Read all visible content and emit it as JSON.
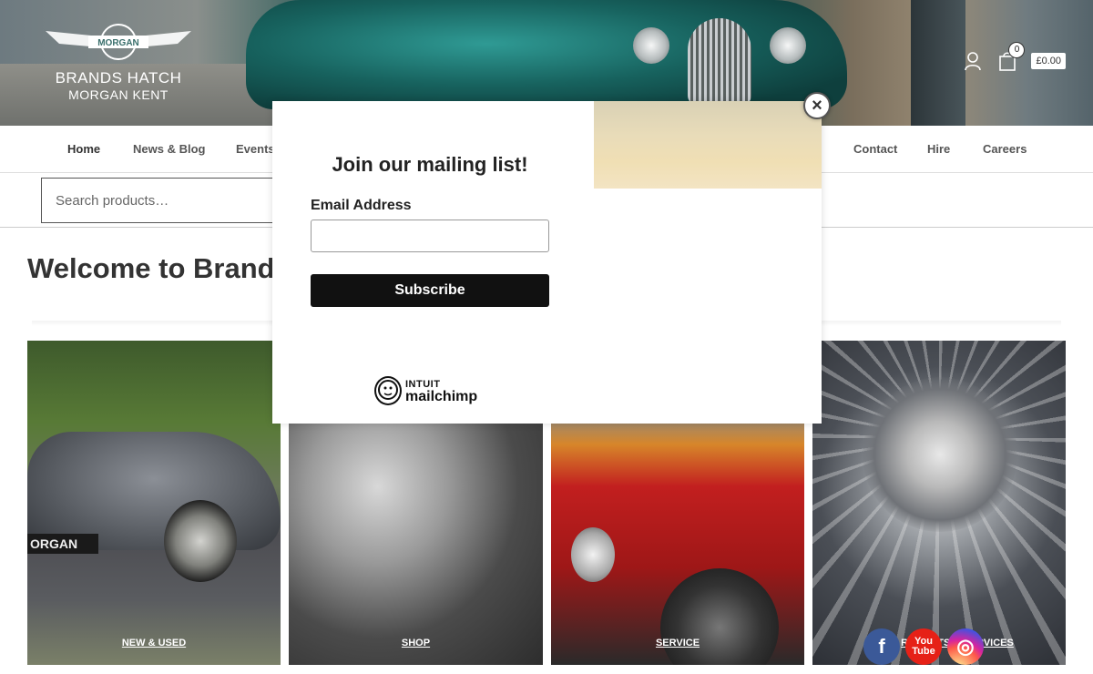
{
  "header": {
    "logo_line1": "BRANDS HATCH",
    "logo_line2": "MORGAN KENT",
    "logo_badge": "MORGAN",
    "cart_count": "0",
    "cart_total": "£0.00",
    "icons": [
      "user-icon",
      "shopping-bag-icon"
    ]
  },
  "nav": {
    "items": [
      "Home",
      "News & Blog",
      "Events",
      "Contact",
      "Hire",
      "Careers"
    ]
  },
  "search": {
    "placeholder": "Search products…"
  },
  "main": {
    "welcome": "Welcome to Brands",
    "tiles": [
      "NEW & USED",
      "SHOP",
      "SERVICE",
      "RT PARTS & SERVICES"
    ],
    "tile_plate": "ORGAN"
  },
  "modal": {
    "title": "Join our mailing list!",
    "email_label": "Email Address",
    "subscribe": "Subscribe",
    "brand_line1": "INTUIT",
    "brand_line2": "mailchimp",
    "close": "×"
  },
  "social": {
    "facebook": "f",
    "youtube": "You\nTube",
    "instagram": "◎"
  },
  "colors": {
    "accent_dark": "#111111",
    "teal": "#1f6f6b",
    "facebook": "#3b5998",
    "youtube": "#e62117"
  }
}
